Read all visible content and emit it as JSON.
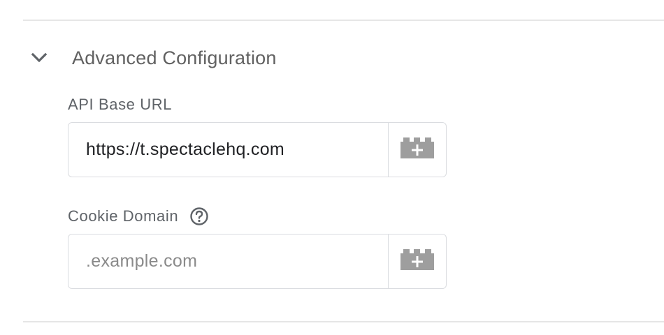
{
  "section": {
    "title": "Advanced Configuration",
    "expanded": true,
    "chevron_icon": "chevron-down-icon"
  },
  "fields": {
    "api_base_url": {
      "label": "API Base URL",
      "value": "https://t.spectaclehq.com",
      "placeholder": "",
      "variable_icon": "add-variable-brick-icon"
    },
    "cookie_domain": {
      "label": "Cookie Domain",
      "value": "",
      "placeholder": ".example.com",
      "help_icon": "help-circle-icon",
      "variable_icon": "add-variable-brick-icon"
    }
  },
  "colors": {
    "label_text": "#5f6368",
    "title_text": "#616161",
    "input_text": "#202124",
    "placeholder_text": "#8a8a8a",
    "border": "#dadce0",
    "icon_gray": "#9e9e9e"
  }
}
